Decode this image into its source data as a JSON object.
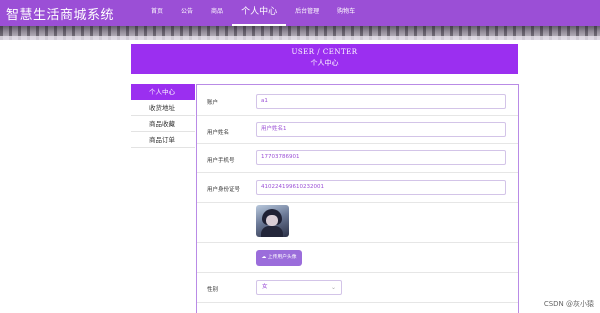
{
  "header": {
    "brand": "智慧生活商城系统",
    "nav": [
      {
        "label": "首页",
        "active": false
      },
      {
        "label": "公告",
        "active": false
      },
      {
        "label": "商品",
        "active": false
      },
      {
        "label": "个人中心",
        "active": true
      },
      {
        "label": "后台管理",
        "active": false
      },
      {
        "label": "购物车",
        "active": false
      }
    ]
  },
  "center": {
    "title_en": "USER / CENTER",
    "title_cn": "个人中心"
  },
  "side_menu": [
    {
      "label": "个人中心",
      "active": true
    },
    {
      "label": "收货地址",
      "active": false
    },
    {
      "label": "商品收藏",
      "active": false
    },
    {
      "label": "商品订单",
      "active": false
    }
  ],
  "form": {
    "account": {
      "label": "账户",
      "value": "a1"
    },
    "username": {
      "label": "用户姓名",
      "value": "用户姓名1"
    },
    "phone": {
      "label": "用户手机号",
      "value": "17703786901"
    },
    "id_card": {
      "label": "用户身份证号",
      "value": "410224199610232001"
    },
    "upload_label": "上传用户头像",
    "gender": {
      "label": "性别",
      "value": "女"
    }
  },
  "colors": {
    "accent": "#9b2ff0",
    "nav_bg": "#9b4fd6",
    "upload_btn": "#9b6ddb"
  },
  "icons": {
    "upload": "cloud-upload-icon",
    "select": "chevron-down-icon"
  },
  "watermark": "CSDN @灰小猿"
}
